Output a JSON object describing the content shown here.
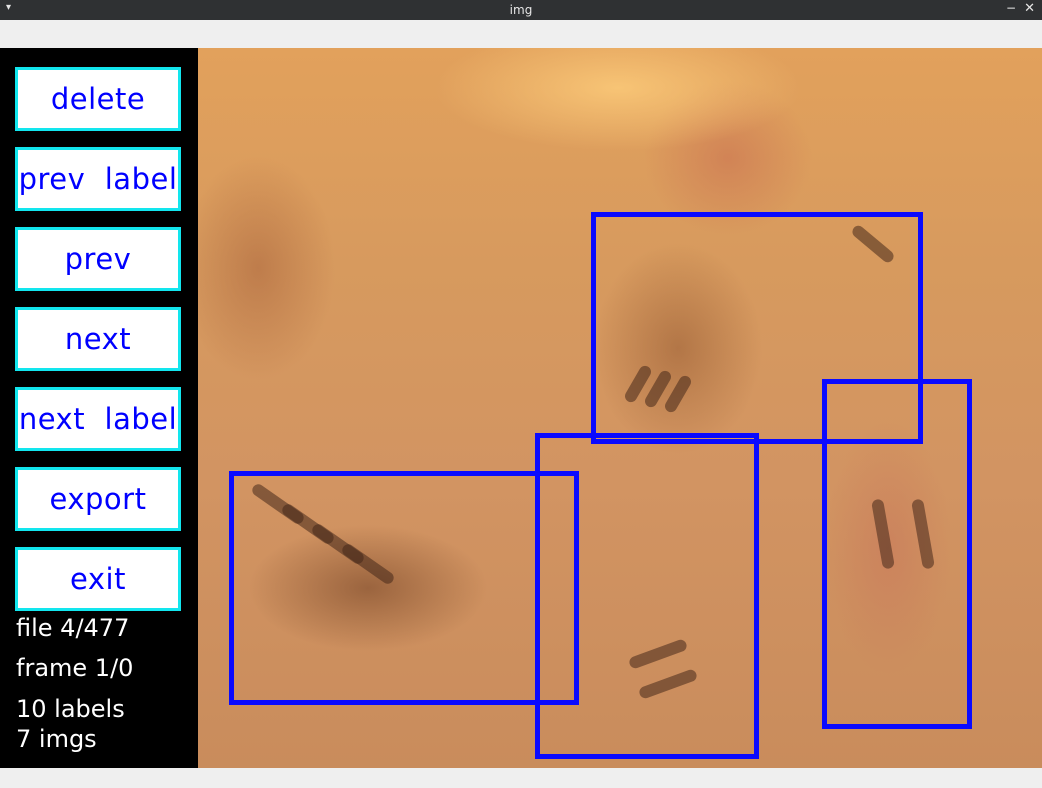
{
  "window": {
    "title": "img",
    "menu_glyph": "▾",
    "minimize_glyph": "−",
    "close_glyph": "✕"
  },
  "sidebar": {
    "buttons": [
      {
        "label": "delete"
      },
      {
        "label": "prev  label"
      },
      {
        "label": "prev"
      },
      {
        "label": "next"
      },
      {
        "label": "next  label"
      },
      {
        "label": "export"
      },
      {
        "label": "exit"
      }
    ],
    "stats": {
      "file": "file 4/477",
      "frame": "frame 1/0",
      "labels": "10 labels",
      "imgs": "7 imgs"
    }
  },
  "annotations": {
    "box_color": "#0a0aff",
    "box_count": 4
  },
  "colors": {
    "button_border": "#12e6ee",
    "button_text": "#0000ff",
    "sidebar_bg": "#000000",
    "titlebar_bg": "#2f3133"
  }
}
